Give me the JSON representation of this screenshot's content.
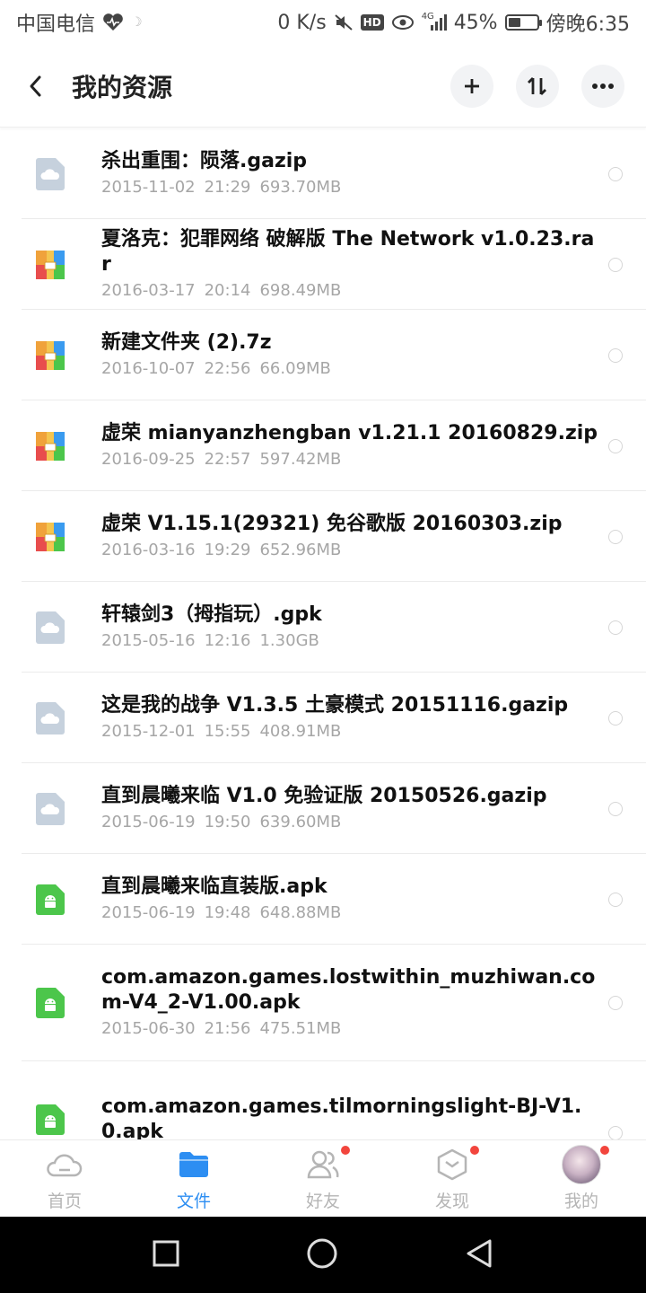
{
  "status_bar": {
    "carrier": "中国电信",
    "speed": "0 K/s",
    "hd": "HD",
    "network": "4G",
    "battery": "45%",
    "battery_level": 0.45,
    "time": "傍晚6:35"
  },
  "header": {
    "title": "我的资源"
  },
  "files": [
    {
      "name": "杀出重围：陨落.gazip",
      "date": "2015-11-02",
      "time": "21:29",
      "size": "693.70MB",
      "icon": "cloud-file-icon"
    },
    {
      "name": "夏洛克：犯罪网络 破解版 The Network v1.0.23.rar",
      "date": "2016-03-17",
      "time": "20:14",
      "size": "698.49MB",
      "icon": "archive-icon"
    },
    {
      "name": "新建文件夹 (2).7z",
      "date": "2016-10-07",
      "time": "22:56",
      "size": "66.09MB",
      "icon": "archive-icon"
    },
    {
      "name": "虚荣 mianyanzhengban v1.21.1 20160829.zip",
      "date": "2016-09-25",
      "time": "22:57",
      "size": "597.42MB",
      "icon": "archive-icon"
    },
    {
      "name": "虚荣 V1.15.1(29321) 免谷歌版 20160303.zip",
      "date": "2016-03-16",
      "time": "19:29",
      "size": "652.96MB",
      "icon": "archive-icon"
    },
    {
      "name": "轩辕剑3（拇指玩）.gpk",
      "date": "2015-05-16",
      "time": "12:16",
      "size": "1.30GB",
      "icon": "cloud-file-icon"
    },
    {
      "name": "这是我的战争 V1.3.5 土豪模式 20151116.gazip",
      "date": "2015-12-01",
      "time": "15:55",
      "size": "408.91MB",
      "icon": "cloud-file-icon"
    },
    {
      "name": "直到晨曦来临 V1.0 免验证版 20150526.gazip",
      "date": "2015-06-19",
      "time": "19:50",
      "size": "639.60MB",
      "icon": "cloud-file-icon"
    },
    {
      "name": "直到晨曦来临直装版.apk",
      "date": "2015-06-19",
      "time": "19:48",
      "size": "648.88MB",
      "icon": "android-icon"
    },
    {
      "name": "com.amazon.games.lostwithin_muzhiwan.com-V4_2-V1.00.apk",
      "date": "2015-06-30",
      "time": "21:56",
      "size": "475.51MB",
      "icon": "android-icon"
    },
    {
      "name": "com.amazon.games.tilmorningslight-BJ-V1.0.apk",
      "date": "",
      "time": "",
      "size": "",
      "icon": "android-icon"
    }
  ],
  "tabs": [
    {
      "label": "首页",
      "icon": "cloud-icon",
      "badge": false,
      "active": false
    },
    {
      "label": "文件",
      "icon": "folder-icon",
      "badge": false,
      "active": true
    },
    {
      "label": "好友",
      "icon": "friends-icon",
      "badge": true,
      "active": false
    },
    {
      "label": "发现",
      "icon": "discover-icon",
      "badge": true,
      "active": false
    },
    {
      "label": "我的",
      "icon": "avatar",
      "badge": true,
      "active": false
    }
  ],
  "colors": {
    "accent": "#2d8ef2",
    "badge": "#f2453d",
    "apk_green": "#4cc64b",
    "cloud_gray": "#c6d1dd"
  }
}
